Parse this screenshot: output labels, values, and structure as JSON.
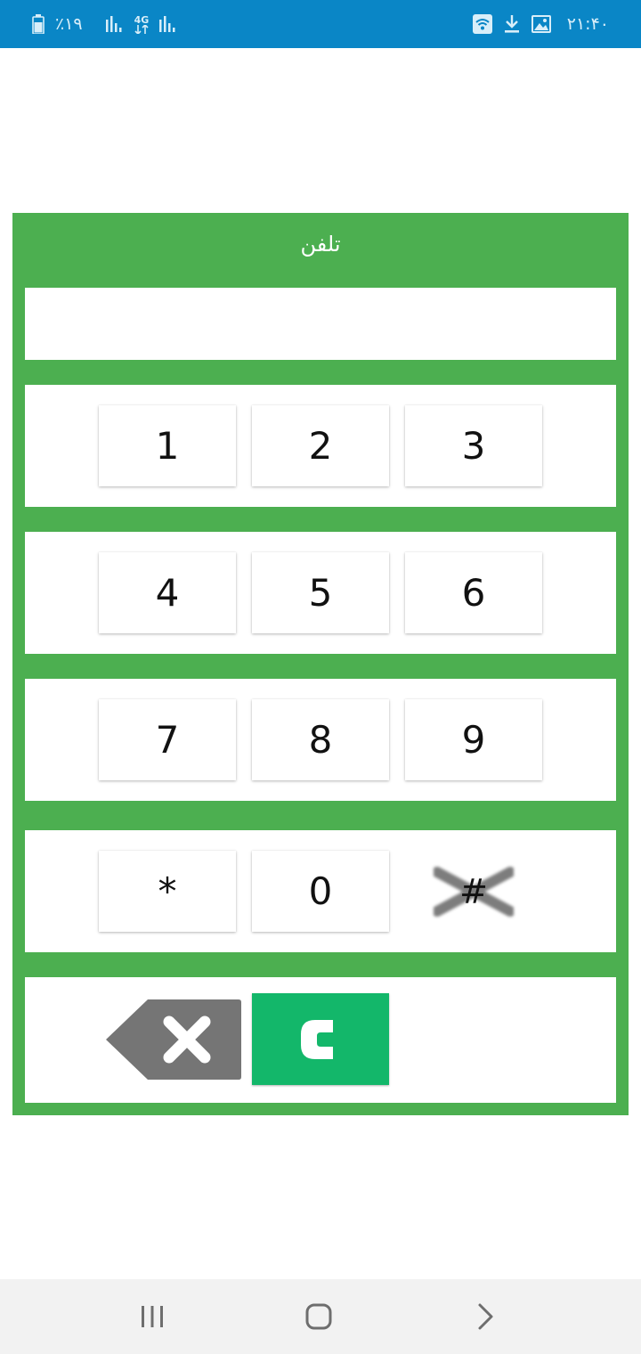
{
  "status_bar": {
    "time": "۲۱:۴۰",
    "battery_percent": "٪۱۹",
    "network_label": "4G",
    "icons": [
      "battery-icon",
      "signal-icon",
      "data-arrows-icon",
      "signal-icon",
      "wifi-icon",
      "download-icon",
      "image-icon"
    ]
  },
  "dialer": {
    "title": "تلفن",
    "number_value": "",
    "keys": {
      "row1": [
        "1",
        "2",
        "3"
      ],
      "row2": [
        "4",
        "5",
        "6"
      ],
      "row3": [
        "7",
        "8",
        "9"
      ],
      "row4": [
        "*",
        "0",
        "#"
      ]
    },
    "controls": {
      "backspace_icon": "backspace-icon",
      "call_icon": "call-c-icon"
    }
  },
  "nav_bar": {
    "buttons": [
      "recents-icon",
      "home-icon",
      "back-icon"
    ]
  },
  "colors": {
    "status_bar": "#0a86c6",
    "card_green": "#4caf50",
    "call_green": "#13b76a",
    "backspace_gray": "#757575",
    "nav_bar": "#f2f2f2"
  }
}
